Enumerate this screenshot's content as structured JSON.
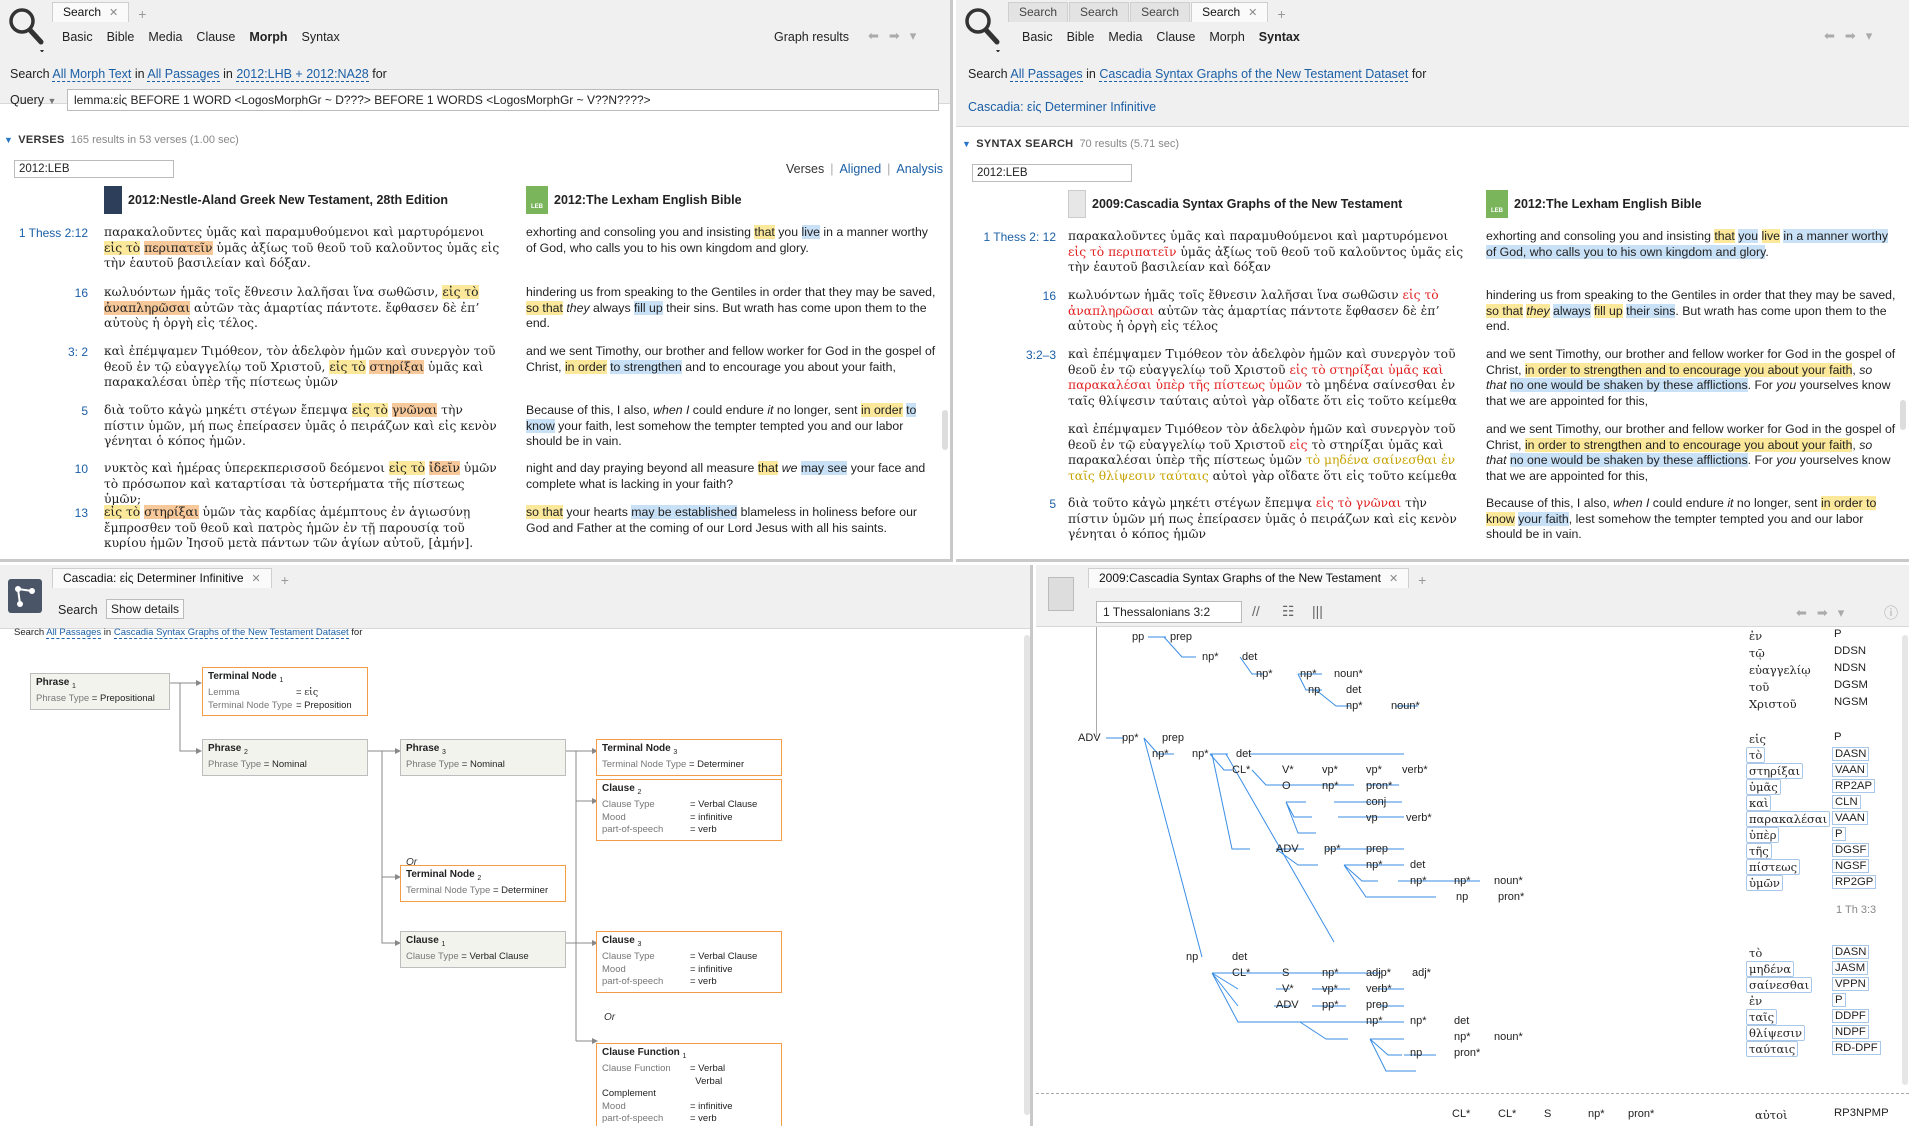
{
  "colors": {
    "link": "#1b5fa6",
    "highlight_yellow": "#fbe89a",
    "highlight_orange": "#f7c99a",
    "highlight_blue": "#c9e1f7",
    "greek_red": "#e02020",
    "node_border": "#f39b45",
    "tree_line": "#3a8ee6"
  },
  "p1": {
    "tabs": [
      "Search"
    ],
    "subtabs": [
      "Basic",
      "Bible",
      "Media",
      "Clause",
      "Morph",
      "Syntax"
    ],
    "graph": "Graph results",
    "search_line": {
      "label": "Search",
      "a": "All Morph Text",
      "in1": "in",
      "b": "All Passages",
      "in2": "in",
      "c": "2012:LHB + 2012:NA28",
      "for": "for"
    },
    "query_label": "Query",
    "query": "lemma:εἰς BEFORE 1 WORD <LogosMorphGr ~ D???> BEFORE 1 WORDS <LogosMorphGr ~ V??N????>",
    "section": "VERSES",
    "stats": "165 results in 53 verses (1.00 sec)",
    "book": "2012:LEB",
    "views": [
      "Verses",
      "Aligned",
      "Analysis"
    ],
    "col1": "2012:Nestle-Aland Greek New Testament, 28th Edition",
    "col2": "2012:The Lexham English Bible",
    "refs": [
      "1 Thess 2:12",
      "16",
      "3:  2",
      "5",
      "10",
      "13"
    ]
  },
  "p2": {
    "tabs": [
      "Search",
      "Search",
      "Search",
      "Search"
    ],
    "subtabs": [
      "Basic",
      "Bible",
      "Media",
      "Clause",
      "Morph",
      "Syntax"
    ],
    "search_line": {
      "label": "Search",
      "a": "All Passages",
      "in": "in",
      "b": "Cascadia Syntax Graphs of the New Testament Dataset",
      "for": "for"
    },
    "query_link": "Cascadia: εἰς Determiner Infinitive",
    "section": "SYNTAX SEARCH",
    "stats": "70 results (5.71 sec)",
    "book": "2012:LEB",
    "col1": "2009:Cascadia Syntax Graphs of the New Testament",
    "col2": "2012:The Lexham English Bible",
    "refs": [
      "1 Thess 2:  12",
      "16",
      "3:2–3",
      "5"
    ]
  },
  "p3": {
    "tab": "Cascadia: εἰς Determiner Infinitive",
    "search_btn": "Search",
    "details_btn": "Show details",
    "search_line": {
      "label": "Search",
      "a": "All Passages",
      "in": "in",
      "b": "Cascadia Syntax Graphs of the New Testament Dataset",
      "for": "for"
    },
    "or": "Or"
  },
  "p4": {
    "tab": "2009:Cascadia Syntax Graphs of the New Testament",
    "ref_input": "1 Thessalonians 3:2",
    "verse_marker": "1 Th 3:3"
  }
}
